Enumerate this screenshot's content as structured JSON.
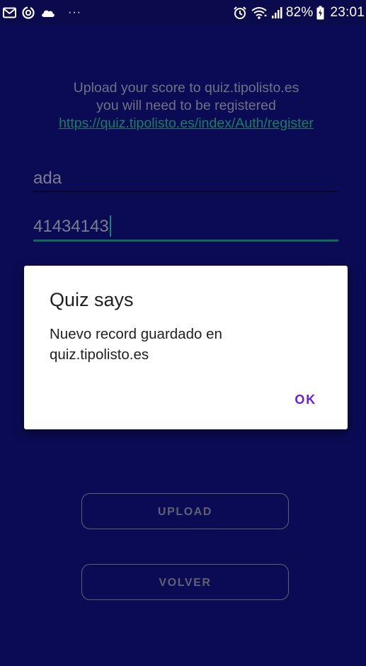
{
  "status_bar": {
    "battery_percent": "82%",
    "time": "23:01",
    "more_indicator": "···",
    "icons": [
      "mail-icon",
      "sync-icon",
      "cloud-icon",
      "alarm-icon",
      "wifi-icon",
      "signal-icon",
      "battery-icon"
    ]
  },
  "form": {
    "info_line1": "Upload your score to quiz.tipolisto.es",
    "info_line2": "you will need to be registered",
    "register_link": "https://quiz.tipolisto.es/index/Auth/register",
    "username_value": "ada",
    "password_value": "41434143"
  },
  "buttons": {
    "upload_label": "UPLOAD",
    "volver_label": "VOLVER"
  },
  "dialog": {
    "title": "Quiz says",
    "message": "Nuevo record guardado en quiz.tipolisto.es",
    "ok_label": "OK"
  },
  "colors": {
    "background": "#0b0b55",
    "status_bar": "#0a0a4d",
    "link": "#1a7e5f",
    "focus_underline": "#0f6b57",
    "dialog_accent": "#6a1fd0"
  }
}
